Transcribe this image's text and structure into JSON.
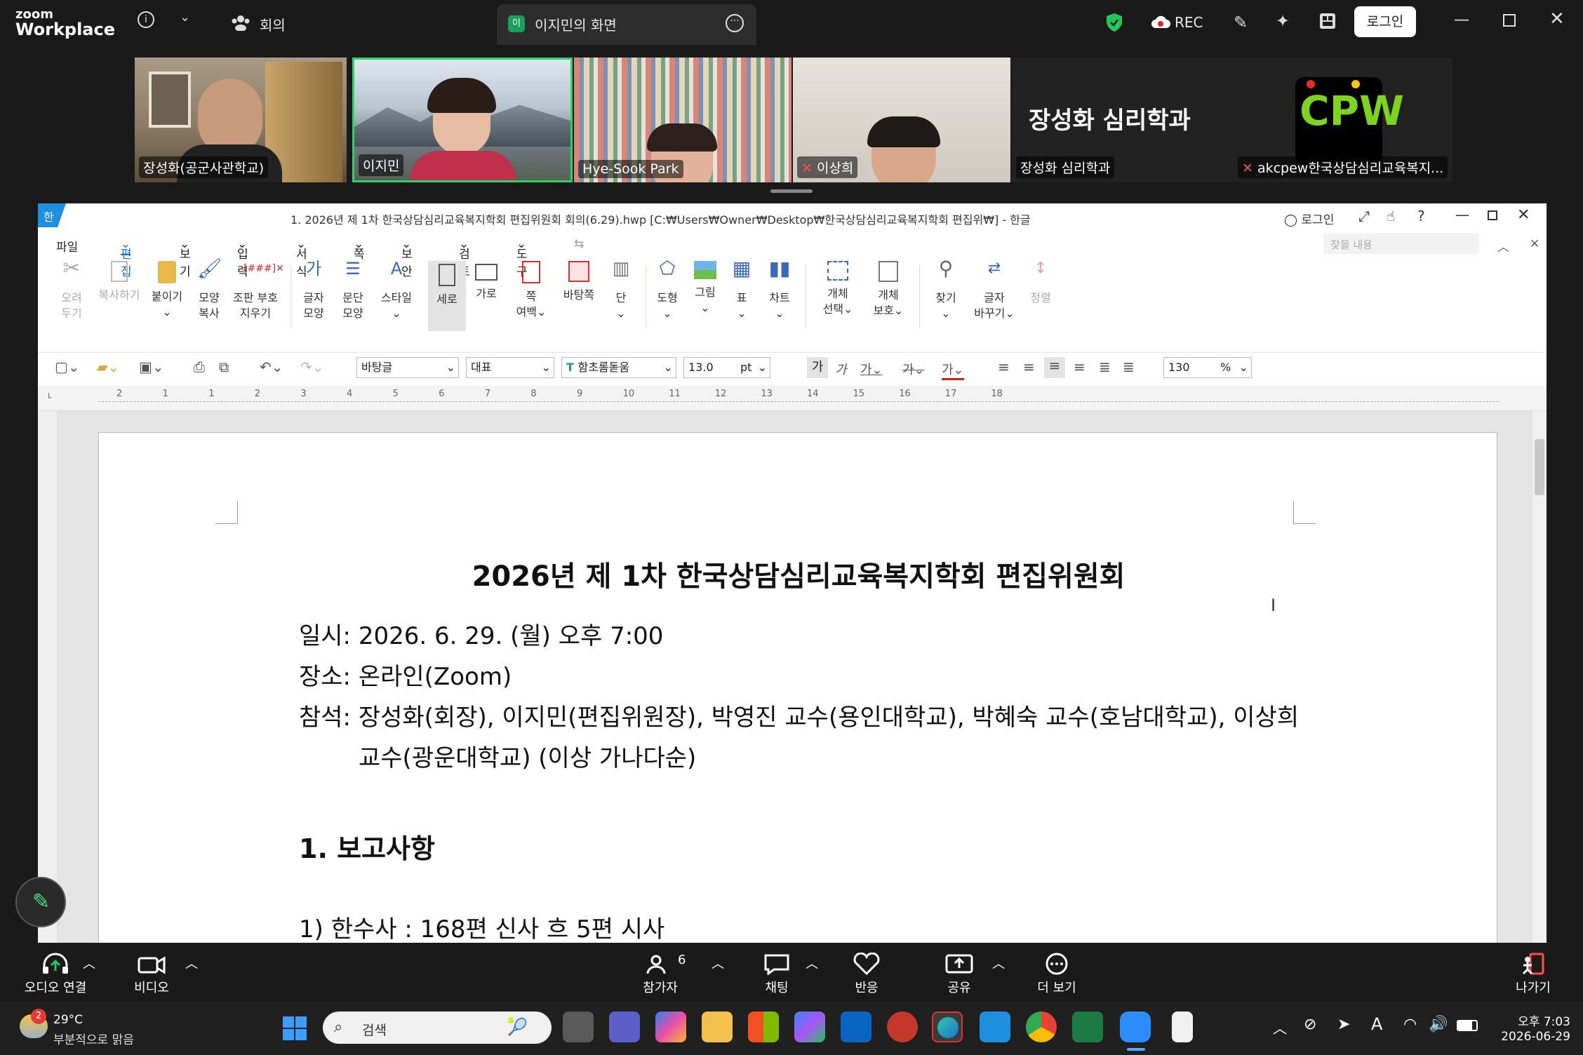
{
  "zoom": {
    "logo_small": "zoom",
    "logo_big": "Workplace",
    "meeting_label": "회의",
    "share_tab_badge": "이",
    "share_tab_label": "이지민의 화면",
    "rec_label": "REC",
    "login_label": "로그인"
  },
  "participants": [
    {
      "name": "장성화(공군사관학교)"
    },
    {
      "name": "이지민"
    },
    {
      "name": "Hye-Sook Park"
    },
    {
      "name": "이상희"
    },
    {
      "name": "장성화 심리학과",
      "big_label": "장성화 심리학과"
    },
    {
      "name": "akcpew한국상담심리교육복지...",
      "logo_text": "CPW"
    }
  ],
  "hwp": {
    "window_title": "1. 2026년 제 1차 한국상담심리교육복지학회 편집위원회 회의(6.29).hwp [C:₩Users₩Owner₩Desktop₩한국상담심리교육복지학회 편집위₩] - 한글",
    "login_label": "로그인",
    "menu": [
      "파일",
      "편집",
      "보기",
      "입력",
      "서식",
      "쪽",
      "보안",
      "검토",
      "도구"
    ],
    "search_placeholder": "찾을 내용",
    "ribbon": [
      {
        "l1": "오려",
        "l2": "두기"
      },
      {
        "l1": "복사하기",
        "l2": ""
      },
      {
        "l1": "붙이기",
        "l2": ""
      },
      {
        "l1": "모양",
        "l2": "복사"
      },
      {
        "l1": "조판 부호",
        "l2": "지우기"
      },
      {
        "l1": "글자",
        "l2": "모양"
      },
      {
        "l1": "문단",
        "l2": "모양"
      },
      {
        "l1": "스타일",
        "l2": ""
      },
      {
        "l1": "세로",
        "l2": ""
      },
      {
        "l1": "가로",
        "l2": ""
      },
      {
        "l1": "쪽",
        "l2": "여백"
      },
      {
        "l1": "바탕쪽",
        "l2": ""
      },
      {
        "l1": "단",
        "l2": ""
      },
      {
        "l1": "도형",
        "l2": ""
      },
      {
        "l1": "그림",
        "l2": ""
      },
      {
        "l1": "표",
        "l2": ""
      },
      {
        "l1": "차트",
        "l2": ""
      },
      {
        "l1": "개체",
        "l2": "선택"
      },
      {
        "l1": "개체",
        "l2": "보호"
      },
      {
        "l1": "찾기",
        "l2": ""
      },
      {
        "l1": "글자",
        "l2": "바꾸기"
      },
      {
        "l1": "정렬",
        "l2": ""
      }
    ],
    "format": {
      "style": "바탕글",
      "lang": "대표",
      "font": "함초롬돋움",
      "size": "13.0",
      "unit": "pt",
      "zoom": "130",
      "zoom_unit": "%",
      "char_btn": "가"
    },
    "ruler_marks": [
      "2",
      "1",
      "1",
      "2",
      "3",
      "4",
      "5",
      "6",
      "7",
      "8",
      "9",
      "10",
      "11",
      "12",
      "13",
      "14",
      "15",
      "16",
      "17",
      "18"
    ],
    "document": {
      "title": "2026년 제 1차 한국상담심리교육복지학회 편집위원회",
      "lines": [
        "일시:  2026. 6. 29. (월) 오후 7:00",
        "장소:  온라인(Zoom)",
        "참석:  장성화(회장), 이지민(편집위원장), 박영진 교수(용인대학교), 박혜숙 교수(호남대학교), 이상희",
        "교수(광운대학교) (이상 가나다순)"
      ],
      "section": "1. 보고사항",
      "partial": "1) 한수사 : 168편 신사 흐 5편 시사"
    }
  },
  "controls": {
    "audio": "오디오 연결",
    "video": "비디오",
    "participants": "참가자",
    "participants_count": "6",
    "chat": "채팅",
    "react": "반응",
    "share": "공유",
    "more": "더 보기",
    "leave": "나가기"
  },
  "taskbar": {
    "weather_temp": "29°C",
    "weather_desc": "부분적으로 맑음",
    "weather_badge": "2",
    "search": "검색",
    "time": "오후 7:03",
    "date": "2026-06-29"
  }
}
